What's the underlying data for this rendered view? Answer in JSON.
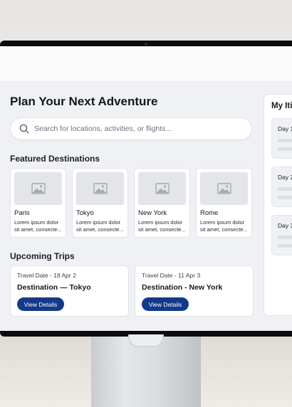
{
  "page": {
    "title": "Plan Your Next Adventure"
  },
  "search": {
    "placeholder": "Search for locations, activities, or flights..."
  },
  "featured": {
    "heading": "Featured Destinations",
    "items": [
      {
        "name": "Paris",
        "desc_line1": "Lorem ipsum dolor",
        "desc_line2": "sit amet, consecte..."
      },
      {
        "name": "Tokyo",
        "desc_line1": "Lorem ipsum dolor",
        "desc_line2": "sit amet, consecte..."
      },
      {
        "name": "New York",
        "desc_line1": "Lorem ipsum dolor",
        "desc_line2": "sit amet, consecte..."
      },
      {
        "name": "Rome",
        "desc_line1": "Lorem ipsum dolor",
        "desc_line2": "sit amet, consecte..."
      }
    ]
  },
  "upcoming": {
    "heading": "Upcoming Trips",
    "trips": [
      {
        "date": "Travel Date - 18 Apr 2",
        "destination": "Destination — Tokyo",
        "button": "View Details"
      },
      {
        "date": "Travel Date - 11 Apr 3",
        "destination": "Destination - New York",
        "button": "View Details"
      }
    ]
  },
  "itinerary": {
    "title": "My Iti",
    "days": [
      {
        "label": "Day 1"
      },
      {
        "label": "Day 2"
      },
      {
        "label": "Day 3"
      }
    ]
  },
  "colors": {
    "primary_button": "#13398a",
    "app_background": "#eff1f4",
    "card_background": "#ffffff",
    "placeholder_image": "#e3e5e9"
  },
  "icons": {
    "search": "search-icon",
    "image_placeholder": "image-placeholder-icon"
  }
}
